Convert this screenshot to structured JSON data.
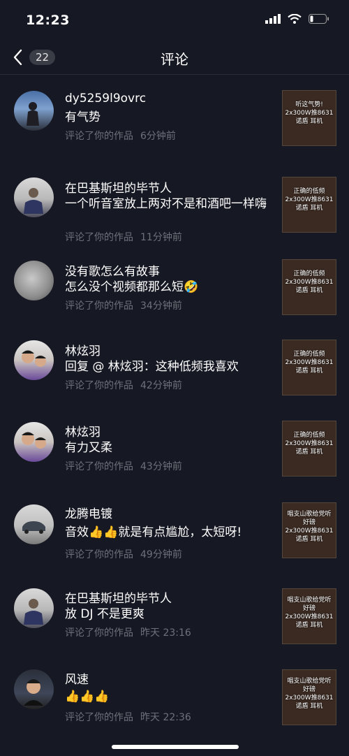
{
  "status": {
    "time": "12:23"
  },
  "nav": {
    "count": "22",
    "title": "评论"
  },
  "items": [
    {
      "name": "dy5259l9ovrc",
      "text": "有气势",
      "action": "评论了你的作品",
      "time": "6分钟前",
      "thumb": [
        "听这气势!",
        "2x300W推8631",
        "诺盾 耳机"
      ]
    },
    {
      "name": "在巴基斯坦的毕节人",
      "text": "一个听音室放上两对不是和酒吧一样嗨",
      "action": "评论了你的作品",
      "time": "11分钟前",
      "thumb": [
        "正确的低频",
        "2x300W推8631",
        "诺盾 耳机"
      ]
    },
    {
      "name": "没有歌怎么有故事",
      "text": "怎么没个视频都那么短🤣",
      "action": "评论了你的作品",
      "time": "34分钟前",
      "thumb": [
        "正确的低频",
        "2x300W推8631",
        "诺盾 耳机"
      ]
    },
    {
      "name": "林炫羽",
      "text": "回复 @ 林炫羽：这种低频我喜欢",
      "action": "评论了你的作品",
      "time": "42分钟前",
      "thumb": [
        "正确的低频",
        "2x300W推8631",
        "诺盾 耳机"
      ]
    },
    {
      "name": "林炫羽",
      "text": "有力又柔",
      "action": "评论了你的作品",
      "time": "43分钟前",
      "thumb": [
        "正确的低频",
        "2x300W推8631",
        "诺盾 耳机"
      ]
    },
    {
      "name": "龙腾电镀",
      "text": "音效👍👍就是有点尴尬，太短呀!",
      "action": "评论了你的作品",
      "time": "49分钟前",
      "thumb": [
        "唱支山歌给党听",
        "好磅",
        "2x300W推8631",
        "诺盾 耳机"
      ]
    },
    {
      "name": "在巴基斯坦的毕节人",
      "text": "放 DJ 不是更爽",
      "action": "评论了你的作品",
      "time": "昨天 23:16",
      "thumb": [
        "唱支山歌给党听",
        "好磅",
        "2x300W推8631",
        "诺盾 耳机"
      ]
    },
    {
      "name": "风速",
      "text": "👍👍👍",
      "action": "评论了你的作品",
      "time": "昨天 22:36",
      "thumb": [
        "唱支山歌给党听",
        "好磅",
        "2x300W推8631",
        "诺盾 耳机"
      ]
    }
  ]
}
